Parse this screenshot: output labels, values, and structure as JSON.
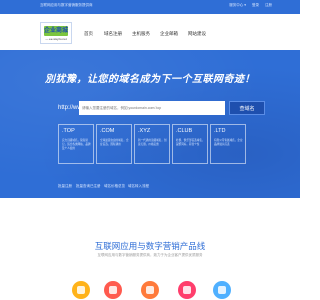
{
  "topbar": {
    "notice": "互联网应用与数字营销服务提供商",
    "links": [
      "服务中心 ▾",
      "登录",
      "注册"
    ]
  },
  "logo": {
    "mark": "企业商城",
    "sub": "— ee.wsyzo.net"
  },
  "nav": [
    "首页",
    "域名注册",
    "主机服务",
    "企业邮箱",
    "网站建设"
  ],
  "hero": {
    "slogan": "別犹豫，让您的域名成为下一个互联网奇迹！",
    "search_prefix": "http://www.",
    "search_placeholder": "请输入您要注册的域名，例如:yourdomain.com/.top",
    "search_button": "查域名",
    "tlds": [
      {
        "name": ".TOP",
        "desc": "实力顶级域名，简短易记，适合各类网站、品牌及个人使用"
      },
      {
        "name": ".COM",
        "desc": "全球最受欢迎的域名，企业首选，国际通用"
      },
      {
        "name": ".XYZ",
        "desc": "新一代通用顶级域名，创意无限，价格实惠"
      },
      {
        "name": ".CLUB",
        "desc": "社群、俱乐部首选域名，凝聚同好，彰显个性"
      },
      {
        "name": ".LTD",
        "desc": "有限公司专属域名，企业品牌展示首选"
      }
    ],
    "links": [
      "批量注册",
      "批量查询已注册",
      "域名价格总览",
      "域名转入流程"
    ]
  },
  "section": {
    "title": "互联网应用与数字营销产品线",
    "subtitle": "互联网应用与数字营销服务提供商，致力于为企业客户提供优质服务"
  },
  "product_colors": [
    "#ffb31a",
    "#ff5a4e",
    "#ff7a3a",
    "#ff3e6c",
    "#4fb0ff"
  ]
}
